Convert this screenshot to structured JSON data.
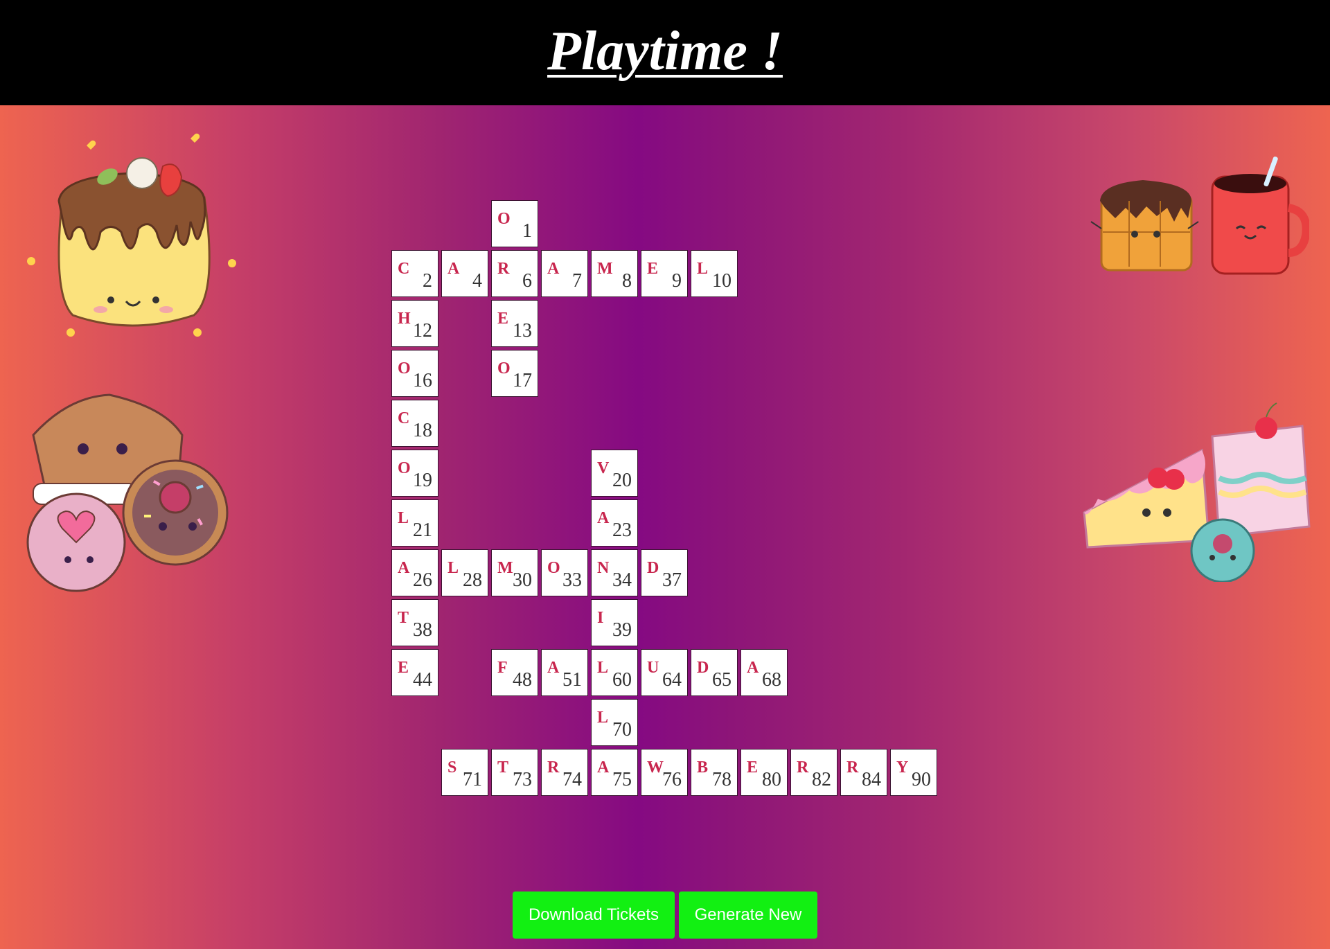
{
  "header": {
    "title": "Playtime !"
  },
  "board": {
    "cells": [
      {
        "letter": "O",
        "number": "1",
        "row": 0,
        "col": 2
      },
      {
        "letter": "C",
        "number": "2",
        "row": 1,
        "col": 0
      },
      {
        "letter": "A",
        "number": "4",
        "row": 1,
        "col": 1
      },
      {
        "letter": "R",
        "number": "6",
        "row": 1,
        "col": 2
      },
      {
        "letter": "A",
        "number": "7",
        "row": 1,
        "col": 3
      },
      {
        "letter": "M",
        "number": "8",
        "row": 1,
        "col": 4
      },
      {
        "letter": "E",
        "number": "9",
        "row": 1,
        "col": 5
      },
      {
        "letter": "L",
        "number": "10",
        "row": 1,
        "col": 6
      },
      {
        "letter": "H",
        "number": "12",
        "row": 2,
        "col": 0
      },
      {
        "letter": "E",
        "number": "13",
        "row": 2,
        "col": 2
      },
      {
        "letter": "O",
        "number": "16",
        "row": 3,
        "col": 0
      },
      {
        "letter": "O",
        "number": "17",
        "row": 3,
        "col": 2
      },
      {
        "letter": "C",
        "number": "18",
        "row": 4,
        "col": 0
      },
      {
        "letter": "O",
        "number": "19",
        "row": 5,
        "col": 0
      },
      {
        "letter": "V",
        "number": "20",
        "row": 5,
        "col": 4
      },
      {
        "letter": "L",
        "number": "21",
        "row": 6,
        "col": 0
      },
      {
        "letter": "A",
        "number": "23",
        "row": 6,
        "col": 4
      },
      {
        "letter": "A",
        "number": "26",
        "row": 7,
        "col": 0
      },
      {
        "letter": "L",
        "number": "28",
        "row": 7,
        "col": 1
      },
      {
        "letter": "M",
        "number": "30",
        "row": 7,
        "col": 2
      },
      {
        "letter": "O",
        "number": "33",
        "row": 7,
        "col": 3
      },
      {
        "letter": "N",
        "number": "34",
        "row": 7,
        "col": 4
      },
      {
        "letter": "D",
        "number": "37",
        "row": 7,
        "col": 5
      },
      {
        "letter": "T",
        "number": "38",
        "row": 8,
        "col": 0
      },
      {
        "letter": "I",
        "number": "39",
        "row": 8,
        "col": 4
      },
      {
        "letter": "E",
        "number": "44",
        "row": 9,
        "col": 0
      },
      {
        "letter": "F",
        "number": "48",
        "row": 9,
        "col": 2
      },
      {
        "letter": "A",
        "number": "51",
        "row": 9,
        "col": 3
      },
      {
        "letter": "L",
        "number": "60",
        "row": 9,
        "col": 4
      },
      {
        "letter": "U",
        "number": "64",
        "row": 9,
        "col": 5
      },
      {
        "letter": "D",
        "number": "65",
        "row": 9,
        "col": 6
      },
      {
        "letter": "A",
        "number": "68",
        "row": 9,
        "col": 7
      },
      {
        "letter": "L",
        "number": "70",
        "row": 10,
        "col": 4
      },
      {
        "letter": "S",
        "number": "71",
        "row": 11,
        "col": 1
      },
      {
        "letter": "T",
        "number": "73",
        "row": 11,
        "col": 2
      },
      {
        "letter": "R",
        "number": "74",
        "row": 11,
        "col": 3
      },
      {
        "letter": "A",
        "number": "75",
        "row": 11,
        "col": 4
      },
      {
        "letter": "W",
        "number": "76",
        "row": 11,
        "col": 5
      },
      {
        "letter": "B",
        "number": "78",
        "row": 11,
        "col": 6
      },
      {
        "letter": "E",
        "number": "80",
        "row": 11,
        "col": 7
      },
      {
        "letter": "R",
        "number": "82",
        "row": 11,
        "col": 8
      },
      {
        "letter": "R",
        "number": "84",
        "row": 11,
        "col": 9
      },
      {
        "letter": "Y",
        "number": "90",
        "row": 11,
        "col": 10
      }
    ]
  },
  "actions": {
    "download_label": "Download Tickets",
    "generate_label": "Generate New"
  },
  "stickers": [
    "pudding-sticker",
    "cookies-donut-sticker",
    "waffle-mug-sticker",
    "cakes-sticker"
  ],
  "colors": {
    "header_bg": "#000000",
    "letter": "#c8264e",
    "number": "#333333",
    "button": "#12f012"
  }
}
